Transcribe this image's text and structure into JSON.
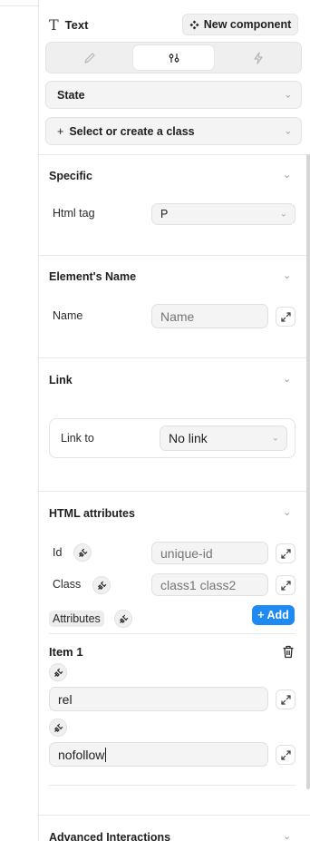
{
  "header": {
    "element_type": "Text",
    "new_component_label": "New component"
  },
  "tabs": [
    {
      "icon": "pencil-icon",
      "active": false
    },
    {
      "icon": "sliders-icon",
      "active": true
    },
    {
      "icon": "bolt-icon",
      "active": false
    }
  ],
  "state_dropdown": {
    "label": "State"
  },
  "class_dropdown": {
    "label": "Select or create a class"
  },
  "sections": {
    "specific": {
      "title": "Specific",
      "html_tag_label": "Html tag",
      "html_tag_value": "P"
    },
    "element_name": {
      "title": "Element's Name",
      "name_label": "Name",
      "name_placeholder": "Name"
    },
    "link": {
      "title": "Link",
      "link_to_label": "Link to",
      "link_to_value": "No link"
    },
    "html_attributes": {
      "title": "HTML attributes",
      "id_label": "Id",
      "id_placeholder": "unique-id",
      "class_label": "Class",
      "class_placeholder": "class1 class2",
      "attributes_label": "Attributes",
      "add_label": "Add",
      "item": {
        "title": "Item 1",
        "name_value": "rel",
        "value_value": "nofollow"
      }
    },
    "advanced": {
      "title": "Advanced Interactions"
    }
  },
  "colors": {
    "accent": "#1f8bf2",
    "field_bg": "#f4f4f4",
    "border": "#e4e4e4"
  }
}
